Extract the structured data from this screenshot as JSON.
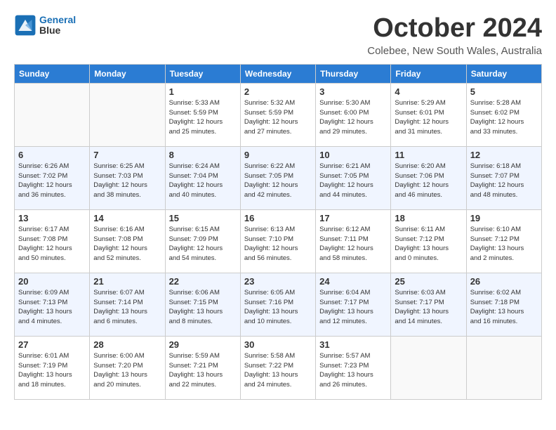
{
  "logo": {
    "line1": "General",
    "line2": "Blue"
  },
  "title": "October 2024",
  "location": "Colebee, New South Wales, Australia",
  "days_of_week": [
    "Sunday",
    "Monday",
    "Tuesday",
    "Wednesday",
    "Thursday",
    "Friday",
    "Saturday"
  ],
  "weeks": [
    [
      {
        "day": "",
        "info": ""
      },
      {
        "day": "",
        "info": ""
      },
      {
        "day": "1",
        "info": "Sunrise: 5:33 AM\nSunset: 5:59 PM\nDaylight: 12 hours\nand 25 minutes."
      },
      {
        "day": "2",
        "info": "Sunrise: 5:32 AM\nSunset: 5:59 PM\nDaylight: 12 hours\nand 27 minutes."
      },
      {
        "day": "3",
        "info": "Sunrise: 5:30 AM\nSunset: 6:00 PM\nDaylight: 12 hours\nand 29 minutes."
      },
      {
        "day": "4",
        "info": "Sunrise: 5:29 AM\nSunset: 6:01 PM\nDaylight: 12 hours\nand 31 minutes."
      },
      {
        "day": "5",
        "info": "Sunrise: 5:28 AM\nSunset: 6:02 PM\nDaylight: 12 hours\nand 33 minutes."
      }
    ],
    [
      {
        "day": "6",
        "info": "Sunrise: 6:26 AM\nSunset: 7:02 PM\nDaylight: 12 hours\nand 36 minutes."
      },
      {
        "day": "7",
        "info": "Sunrise: 6:25 AM\nSunset: 7:03 PM\nDaylight: 12 hours\nand 38 minutes."
      },
      {
        "day": "8",
        "info": "Sunrise: 6:24 AM\nSunset: 7:04 PM\nDaylight: 12 hours\nand 40 minutes."
      },
      {
        "day": "9",
        "info": "Sunrise: 6:22 AM\nSunset: 7:05 PM\nDaylight: 12 hours\nand 42 minutes."
      },
      {
        "day": "10",
        "info": "Sunrise: 6:21 AM\nSunset: 7:05 PM\nDaylight: 12 hours\nand 44 minutes."
      },
      {
        "day": "11",
        "info": "Sunrise: 6:20 AM\nSunset: 7:06 PM\nDaylight: 12 hours\nand 46 minutes."
      },
      {
        "day": "12",
        "info": "Sunrise: 6:18 AM\nSunset: 7:07 PM\nDaylight: 12 hours\nand 48 minutes."
      }
    ],
    [
      {
        "day": "13",
        "info": "Sunrise: 6:17 AM\nSunset: 7:08 PM\nDaylight: 12 hours\nand 50 minutes."
      },
      {
        "day": "14",
        "info": "Sunrise: 6:16 AM\nSunset: 7:08 PM\nDaylight: 12 hours\nand 52 minutes."
      },
      {
        "day": "15",
        "info": "Sunrise: 6:15 AM\nSunset: 7:09 PM\nDaylight: 12 hours\nand 54 minutes."
      },
      {
        "day": "16",
        "info": "Sunrise: 6:13 AM\nSunset: 7:10 PM\nDaylight: 12 hours\nand 56 minutes."
      },
      {
        "day": "17",
        "info": "Sunrise: 6:12 AM\nSunset: 7:11 PM\nDaylight: 12 hours\nand 58 minutes."
      },
      {
        "day": "18",
        "info": "Sunrise: 6:11 AM\nSunset: 7:12 PM\nDaylight: 13 hours\nand 0 minutes."
      },
      {
        "day": "19",
        "info": "Sunrise: 6:10 AM\nSunset: 7:12 PM\nDaylight: 13 hours\nand 2 minutes."
      }
    ],
    [
      {
        "day": "20",
        "info": "Sunrise: 6:09 AM\nSunset: 7:13 PM\nDaylight: 13 hours\nand 4 minutes."
      },
      {
        "day": "21",
        "info": "Sunrise: 6:07 AM\nSunset: 7:14 PM\nDaylight: 13 hours\nand 6 minutes."
      },
      {
        "day": "22",
        "info": "Sunrise: 6:06 AM\nSunset: 7:15 PM\nDaylight: 13 hours\nand 8 minutes."
      },
      {
        "day": "23",
        "info": "Sunrise: 6:05 AM\nSunset: 7:16 PM\nDaylight: 13 hours\nand 10 minutes."
      },
      {
        "day": "24",
        "info": "Sunrise: 6:04 AM\nSunset: 7:17 PM\nDaylight: 13 hours\nand 12 minutes."
      },
      {
        "day": "25",
        "info": "Sunrise: 6:03 AM\nSunset: 7:17 PM\nDaylight: 13 hours\nand 14 minutes."
      },
      {
        "day": "26",
        "info": "Sunrise: 6:02 AM\nSunset: 7:18 PM\nDaylight: 13 hours\nand 16 minutes."
      }
    ],
    [
      {
        "day": "27",
        "info": "Sunrise: 6:01 AM\nSunset: 7:19 PM\nDaylight: 13 hours\nand 18 minutes."
      },
      {
        "day": "28",
        "info": "Sunrise: 6:00 AM\nSunset: 7:20 PM\nDaylight: 13 hours\nand 20 minutes."
      },
      {
        "day": "29",
        "info": "Sunrise: 5:59 AM\nSunset: 7:21 PM\nDaylight: 13 hours\nand 22 minutes."
      },
      {
        "day": "30",
        "info": "Sunrise: 5:58 AM\nSunset: 7:22 PM\nDaylight: 13 hours\nand 24 minutes."
      },
      {
        "day": "31",
        "info": "Sunrise: 5:57 AM\nSunset: 7:23 PM\nDaylight: 13 hours\nand 26 minutes."
      },
      {
        "day": "",
        "info": ""
      },
      {
        "day": "",
        "info": ""
      }
    ]
  ]
}
